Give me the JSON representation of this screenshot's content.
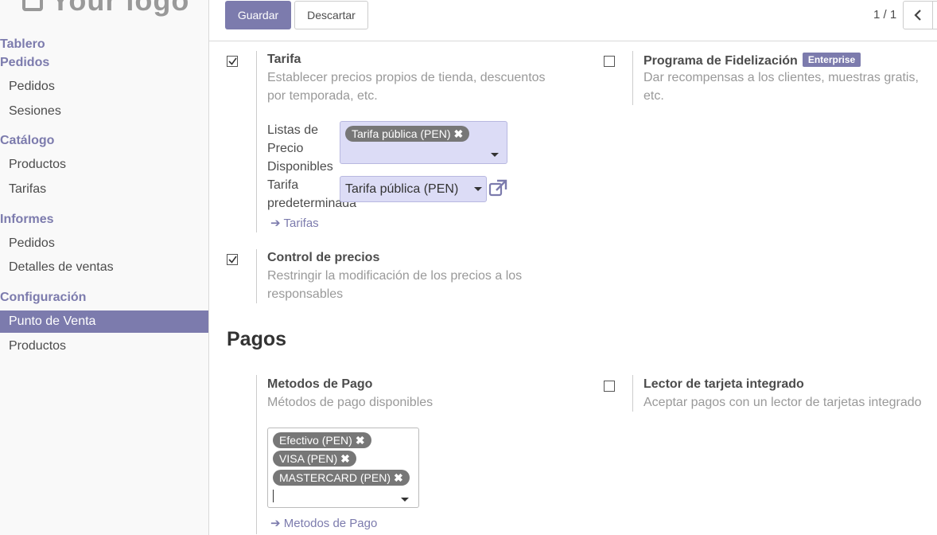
{
  "sidebar": {
    "logo_text": "Your logo",
    "dashboard": "Tablero",
    "orders_section": "Pedidos",
    "orders_items": [
      "Pedidos",
      "Sesiones"
    ],
    "catalog_section": "Catálogo",
    "catalog_items": [
      "Productos",
      "Tarifas"
    ],
    "reports_section": "Informes",
    "reports_items": [
      "Pedidos",
      "Detalles de ventas"
    ],
    "config_section": "Configuración",
    "config_items": [
      "Punto de Venta",
      "Productos"
    ],
    "active_item": "Punto de Venta"
  },
  "toolbar": {
    "save_label": "Guardar",
    "discard_label": "Descartar",
    "pager_value": "1 / 1"
  },
  "settings": {
    "pricelist": {
      "checked": true,
      "title": "Tarifa",
      "desc_line1": "Establecer precios propios de tienda, descuentos",
      "desc_line2": "por temporada, etc.",
      "available_label": [
        "Listas de",
        "Precio",
        "Disponibles"
      ],
      "available_tags": [
        "Tarifa pública (PEN)"
      ],
      "default_label": [
        "Tarifa",
        "predeterminada"
      ],
      "default_value": "Tarifa pública (PEN)",
      "link": "Tarifas"
    },
    "loyalty": {
      "checked": false,
      "title": "Programa de Fidelización",
      "badge": "Enterprise",
      "desc_line1": "Dar recompensas a los clientes, muestras gratis,",
      "desc_line2": "etc."
    },
    "price_control": {
      "checked": true,
      "title": "Control de precios",
      "desc_line1": "Restringir la modificación de los precios a los",
      "desc_line2": "responsables"
    }
  },
  "payments": {
    "section_title": "Pagos",
    "methods": {
      "title": "Metodos de Pago",
      "desc": "Métodos de pago disponibles",
      "tags": [
        "Efectivo (PEN)",
        "VISA (PEN)",
        "MASTERCARD (PEN)"
      ],
      "link": "Metodos de Pago"
    },
    "card_reader": {
      "checked": false,
      "title": "Lector de tarjeta integrado",
      "desc": "Aceptar pagos con un lector de tarjetas integrado"
    }
  },
  "colors": {
    "brand": "#7c7bad",
    "lavender_field": "#dcdcf6",
    "tag_gray": "#777777"
  }
}
